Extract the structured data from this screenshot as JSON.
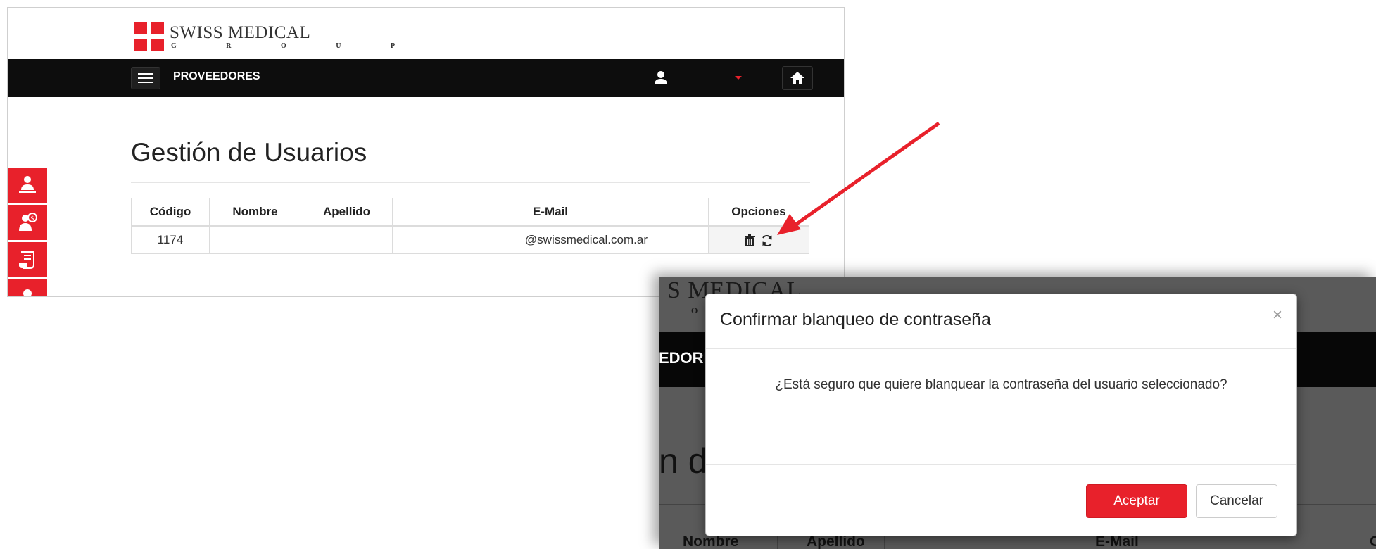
{
  "brand": {
    "name": "SWISS MEDICAL",
    "subtitle": "G R O U P",
    "accent_color": "#e8212b"
  },
  "navbar": {
    "section": "PROVEEDORES",
    "menu_icon": "hamburger-icon",
    "user_icon": "user-icon",
    "dropdown_icon": "caret-down-icon",
    "home_icon": "home-icon"
  },
  "side_tabs": [
    {
      "icon": "person-at-desk-icon"
    },
    {
      "icon": "person-dollar-icon"
    },
    {
      "icon": "scroll-document-icon"
    },
    {
      "icon": "person-icon"
    }
  ],
  "page": {
    "title": "Gestión de Usuarios"
  },
  "table": {
    "headers": [
      "Código",
      "Nombre",
      "Apellido",
      "E-Mail",
      "Opciones"
    ],
    "rows": [
      {
        "codigo": "1174",
        "nombre": "",
        "apellido": "",
        "email": "@swissmedical.com.ar",
        "options": [
          "trash-icon",
          "refresh-icon"
        ]
      }
    ]
  },
  "background_zoom": {
    "logo_fragment": "S MEDICAL",
    "logo_sub_fragment": "O",
    "nav_fragment": "EDORE",
    "title_fragment": "n d",
    "headers": [
      "Nombre",
      "Apellido",
      "E-Mail",
      "O"
    ]
  },
  "modal": {
    "title": "Confirmar blanqueo de contraseña",
    "close": "×",
    "message": "¿Está seguro que quiere blanquear la contraseña del usuario seleccionado?",
    "accept_label": "Aceptar",
    "cancel_label": "Cancelar"
  }
}
